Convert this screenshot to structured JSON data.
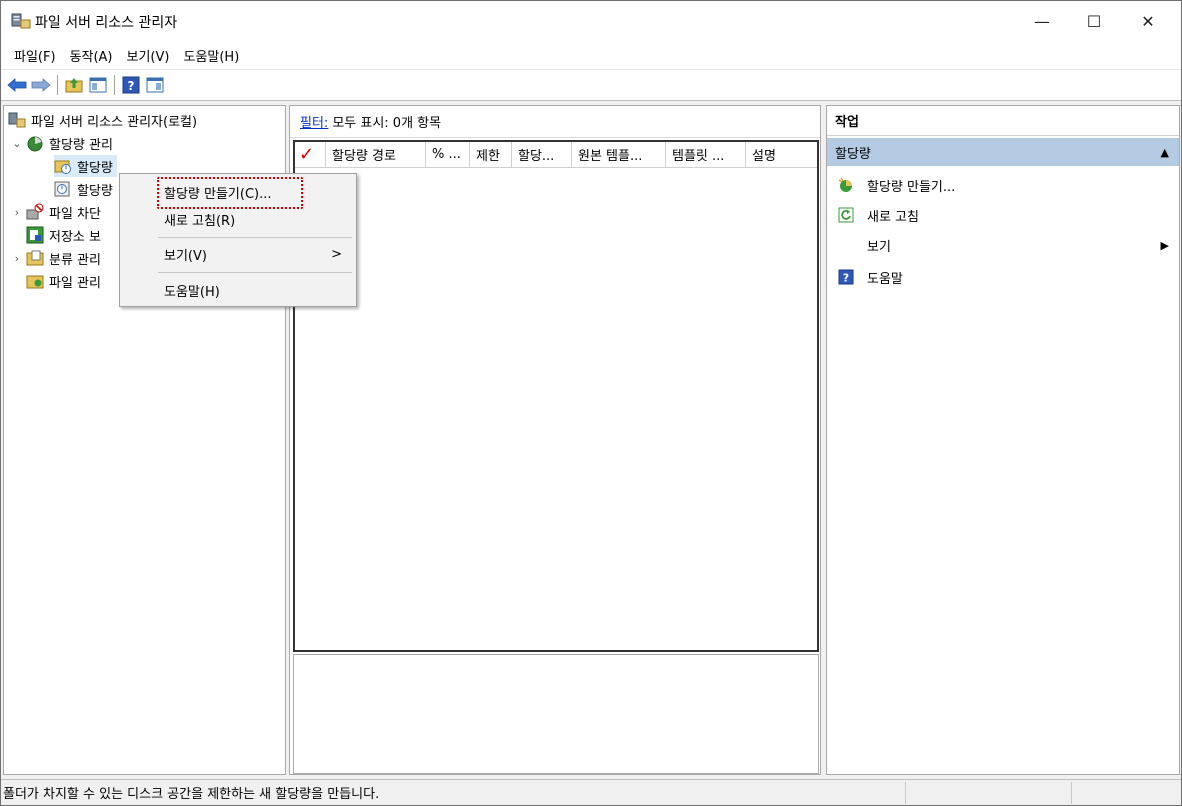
{
  "window": {
    "title": "파일 서버 리소스 관리자",
    "controls": {
      "minimize": "—",
      "maximize": "☐",
      "close": "✕"
    }
  },
  "menu": [
    "파일(F)",
    "동작(A)",
    "보기(V)",
    "도움말(H)"
  ],
  "toolbar": {
    "icons": [
      "back-arrow-icon",
      "forward-arrow-icon",
      "up-folder-icon",
      "show-hide-tree-icon",
      "help-icon",
      "show-hide-action-pane-icon"
    ]
  },
  "tree": {
    "root": "파일 서버 리소스 관리자(로컬)",
    "quota_mgmt": "할당량 관리",
    "quotas": "할당량",
    "quota_templates": "할당량",
    "file_screening": "파일 차단",
    "storage_reports": "저장소 보",
    "classification": "분류 관리",
    "file_mgmt": "파일 관리"
  },
  "context_menu": {
    "create_quota": "할당량 만들기(C)...",
    "refresh": "새로 고침(R)",
    "view": "보기(V)",
    "view_arrow": ">",
    "help": "도움말(H)"
  },
  "middle": {
    "filter_label": "필터:",
    "filter_text": "모두 표시: 0개 항목",
    "checkmark": "✓",
    "columns": [
      "할당량 경로",
      "% ...",
      "제한",
      "할당...",
      "원본 템플...",
      "템플릿 ...",
      "설명"
    ]
  },
  "actions": {
    "header": "작업",
    "section": "할당량",
    "section_arrow": "▲",
    "items": [
      "할당량 만들기...",
      "새로 고침",
      "보기",
      "도움말"
    ],
    "view_arrow": "▶"
  },
  "status": {
    "text": "폴더가 차지할 수 있는 디스크 공간을 제한하는 새 할당량을 만듭니다."
  },
  "colors": {
    "selection": "#d9ebf9",
    "action_section": "#b4cbe3",
    "highlight_red": "#d00000",
    "link": "#0033cc"
  }
}
